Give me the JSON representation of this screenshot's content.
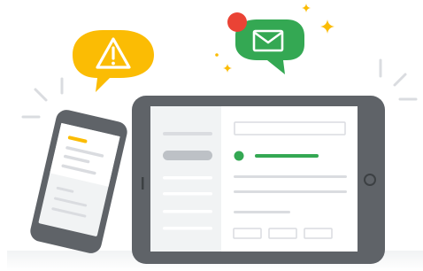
{
  "illustration": {
    "colors": {
      "warning_bubble": "#fbbc04",
      "mail_bubble": "#34a853",
      "notification_dot": "#ea4335",
      "device_frame": "#5f6368",
      "screen": "#f1f3f4",
      "sidebar": "#e8eaed",
      "line": "#dadce0",
      "accent_green": "#34a853",
      "accent_yellow": "#fbbc04",
      "sparkle": "#fbbc04",
      "burst": "#dadce0"
    },
    "icons": {
      "warning": "warning-triangle-icon",
      "mail": "envelope-icon",
      "sparkle": "sparkle-icon"
    }
  }
}
